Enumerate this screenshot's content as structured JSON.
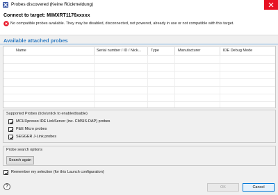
{
  "window": {
    "title": "Probes discovered (Keine Rückmeldung)",
    "app_icon": "x-app-icon",
    "close_icon": "close-icon"
  },
  "header": {
    "title": "Connect to target: MIMXRT1176xxxxx",
    "error_icon": "error-icon",
    "error_text": "No compatible probes available. They may be disabled, disconnected, not powered, already in use or not compatible with this target."
  },
  "probes_section": {
    "title": "Available attached probes",
    "columns": [
      "Name",
      "Serial number / ID / Nick...",
      "Type",
      "Manufacturer",
      "IDE Debug Mode"
    ],
    "rows": []
  },
  "supported_probes": {
    "label": "Supported Probes (tick/untick to enable/disable)",
    "items": [
      {
        "label": "MCUXpresso IDE LinkServer (inc. CMSIS-DAP) probes",
        "checked": true
      },
      {
        "label": "P&E Micro probes",
        "checked": true
      },
      {
        "label": "SEGGER J-Link probes",
        "checked": true
      }
    ]
  },
  "search_options": {
    "label": "Probe search options",
    "search_again": "Search again"
  },
  "remember": {
    "label": "Remember my selection (for this Launch configuration)",
    "checked": true
  },
  "footer": {
    "help": "?",
    "ok": "OK",
    "cancel": "Cancel"
  },
  "colors": {
    "accent": "#2b79c2",
    "error": "#e81123",
    "close": "#e81123"
  }
}
